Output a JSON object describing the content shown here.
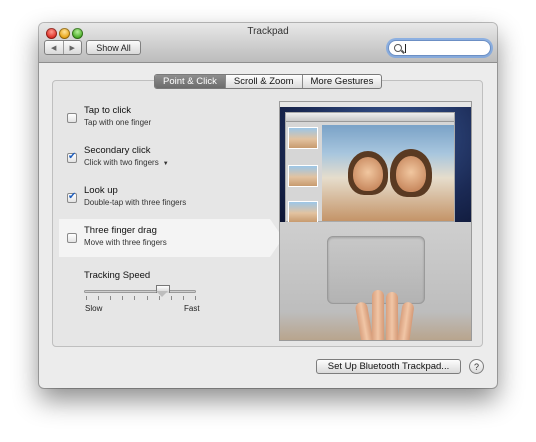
{
  "window": {
    "title": "Trackpad"
  },
  "toolbar": {
    "back_icon": "◀",
    "forward_icon": "▶",
    "show_all_label": "Show All",
    "search_value": ""
  },
  "tabs": [
    {
      "label": "Point & Click",
      "selected": true
    },
    {
      "label": "Scroll & Zoom",
      "selected": false
    },
    {
      "label": "More Gestures",
      "selected": false
    }
  ],
  "options": [
    {
      "title": "Tap to click",
      "subtitle": "Tap with one finger",
      "checked": false,
      "selected": false,
      "has_dropdown": false
    },
    {
      "title": "Secondary click",
      "subtitle": "Click with two fingers",
      "checked": true,
      "selected": false,
      "has_dropdown": true
    },
    {
      "title": "Look up",
      "subtitle": "Double-tap with three fingers",
      "checked": true,
      "selected": false,
      "has_dropdown": false
    },
    {
      "title": "Three finger drag",
      "subtitle": "Move with three fingers",
      "checked": false,
      "selected": true,
      "has_dropdown": false
    }
  ],
  "tracking_speed": {
    "label": "Tracking Speed",
    "min_label": "Slow",
    "max_label": "Fast",
    "tick_count": 10,
    "value_fraction": 0.7
  },
  "footer": {
    "bluetooth_button_label": "Set Up Bluetooth Trackpad...",
    "help_label": "?"
  },
  "colors": {
    "accent": "#1f5fbf",
    "selected_tab_bg": "#7a7a7a",
    "window_bg": "#ececec"
  }
}
